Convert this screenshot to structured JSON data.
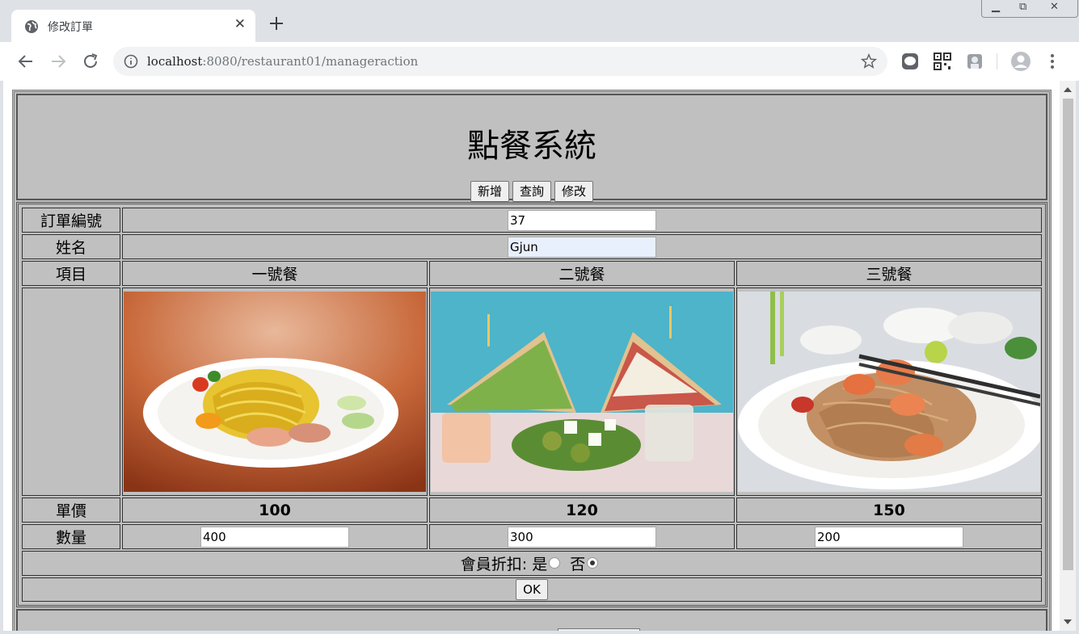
{
  "browser": {
    "tab_title": "修改訂單",
    "url_host": "localhost",
    "url_rest": ":8080/restaurant01/manageraction"
  },
  "page": {
    "title": "點餐系統",
    "buttons": [
      "新增",
      "查詢",
      "修改"
    ],
    "order_id_label": "訂單編號",
    "order_id_value": "37",
    "name_label": "姓名",
    "name_value": "Gjun",
    "item_label": "項目",
    "items": [
      {
        "name": "一號餐",
        "price": "100",
        "quantity": "400"
      },
      {
        "name": "二號餐",
        "price": "120",
        "quantity": "300"
      },
      {
        "name": "三號餐",
        "price": "150",
        "quantity": "200"
      }
    ],
    "price_label": "單價",
    "quantity_label": "數量",
    "discount_label": "會員折扣:",
    "discount_yes": "是",
    "discount_no": "否",
    "discount_selected": "否",
    "ok_label": "OK"
  },
  "colors": {
    "page_bg": "#c0c0c0",
    "chrome_bg": "#dee1e6"
  }
}
